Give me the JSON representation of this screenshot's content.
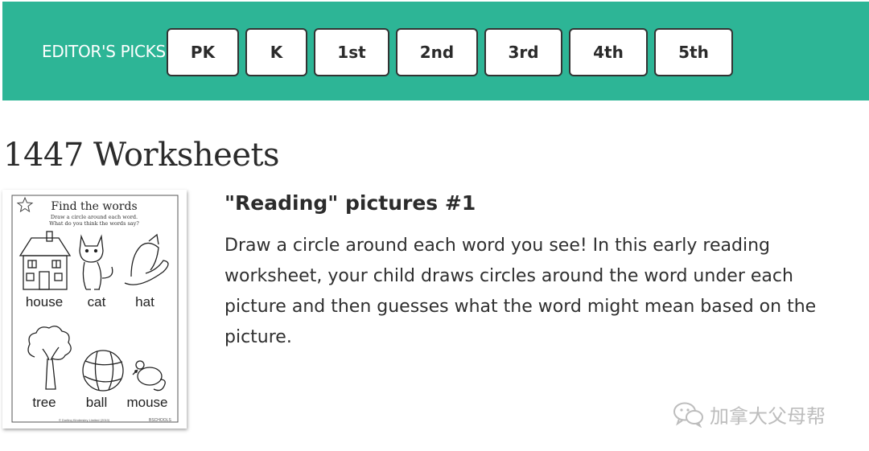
{
  "nav": {
    "label": "EDITOR'S PICKS",
    "grades": [
      "PK",
      "K",
      "1st",
      "2nd",
      "3rd",
      "4th",
      "5th"
    ]
  },
  "results": {
    "count_heading": "1447 Worksheets"
  },
  "worksheet": {
    "title": "\"Reading\" pictures #1",
    "description": "Draw a circle around each word you see! In this early reading worksheet, your child draws circles around the word under each picture and then guesses what the word might mean based on the picture.",
    "thumbnail": {
      "heading": "Find the words",
      "instruction_1": "Draw a circle around each word.",
      "instruction_2": "What do you think the words say?",
      "words": [
        "house",
        "cat",
        "hat",
        "tree",
        "ball",
        "mouse"
      ],
      "footer_left": "© Dorling Kindersley Limited (2010)",
      "footer_right": "BSCHOOLS"
    }
  },
  "watermark": {
    "text": "加拿大父母帮"
  },
  "colors": {
    "brand": "#2db596",
    "text": "#2b2b2b"
  }
}
